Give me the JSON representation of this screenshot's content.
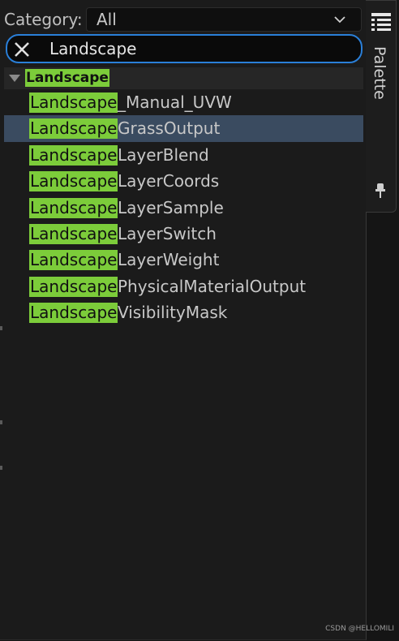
{
  "category": {
    "label": "Category:",
    "selected": "All"
  },
  "search": {
    "value": "Landscape"
  },
  "tree": {
    "category_name": "Landscape",
    "nodes": [
      {
        "match": "Landscape",
        "rest": "_Manual_UVW",
        "selected": false
      },
      {
        "match": "Landscape",
        "rest": "GrassOutput",
        "selected": true
      },
      {
        "match": "Landscape",
        "rest": "LayerBlend",
        "selected": false
      },
      {
        "match": "Landscape",
        "rest": "LayerCoords",
        "selected": false
      },
      {
        "match": "Landscape",
        "rest": "LayerSample",
        "selected": false
      },
      {
        "match": "Landscape",
        "rest": "LayerSwitch",
        "selected": false
      },
      {
        "match": "Landscape",
        "rest": "LayerWeight",
        "selected": false
      },
      {
        "match": "Landscape",
        "rest": "PhysicalMaterialOutput",
        "selected": false
      },
      {
        "match": "Landscape",
        "rest": "VisibilityMask",
        "selected": false
      }
    ]
  },
  "palette_tab": {
    "label": "Palette",
    "icon": "palette-list-icon",
    "pin_icon": "pin-icon"
  },
  "watermark": "CSDN @HELLOMILI",
  "colors": {
    "highlight": "#7ccc3a",
    "selection": "#3a4b60",
    "focus_border": "#2a7fd8"
  }
}
